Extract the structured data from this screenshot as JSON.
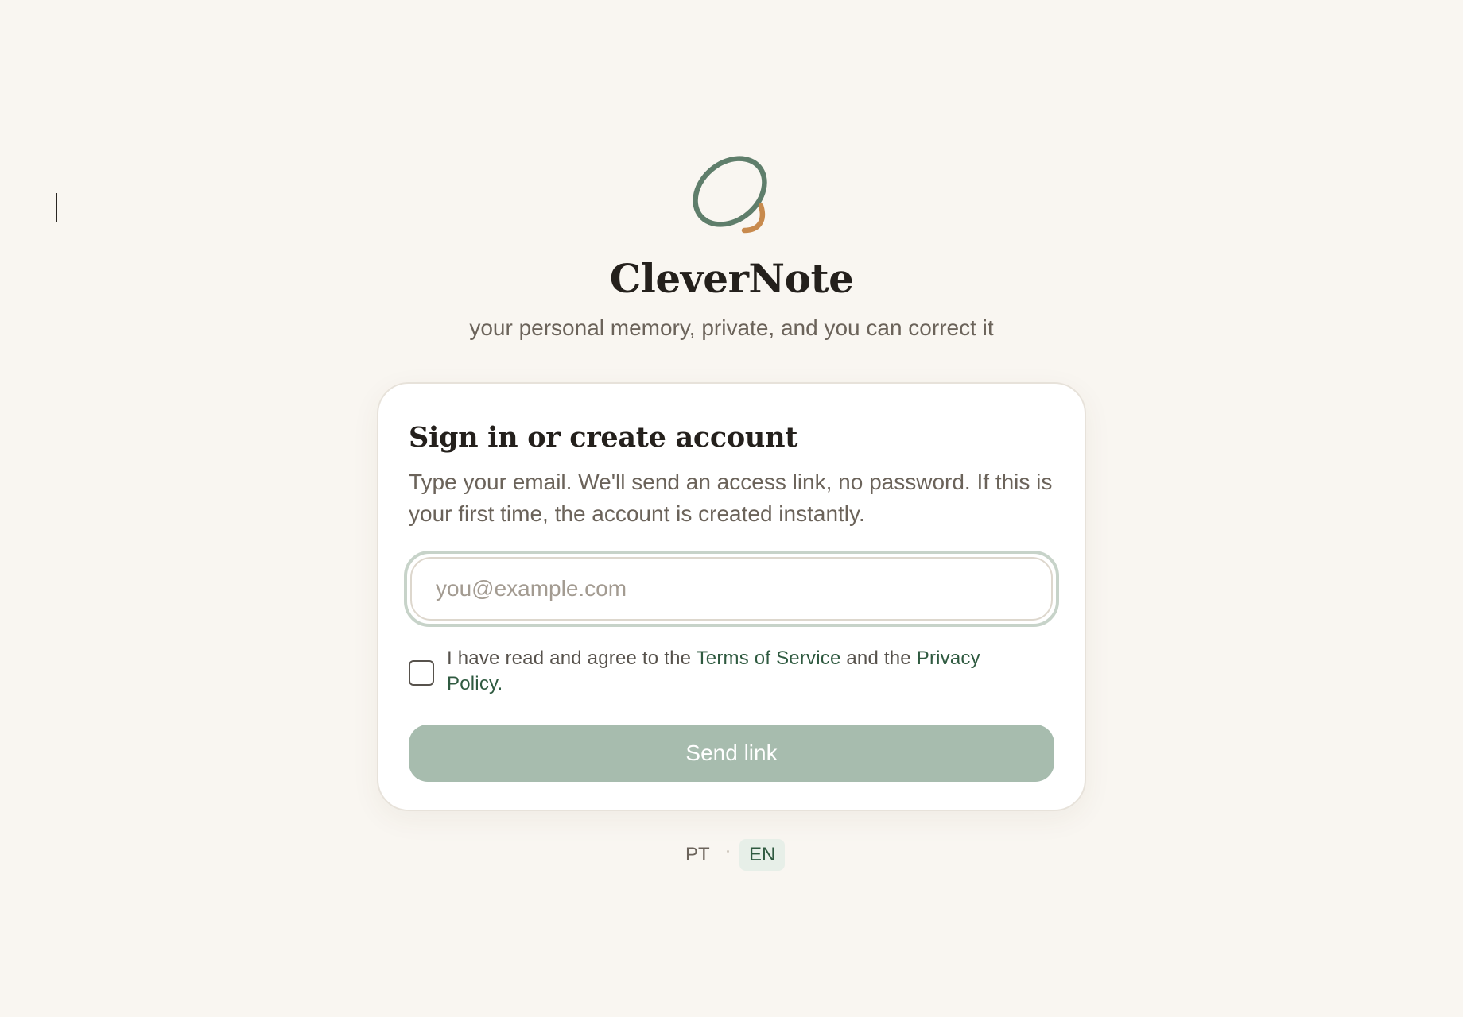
{
  "app": {
    "name": "CleverNote",
    "tagline": "your personal memory, private, and you can correct it",
    "logo_icon": "orbit-loop-logo",
    "colors": {
      "background": "#f9f6f1",
      "accent_green": "#5f7e6b",
      "accent_orange": "#c88a4d",
      "button": "#a7bcae",
      "link": "#2f5a40"
    }
  },
  "card": {
    "title": "Sign in or create account",
    "description": "Type your email. We'll send an access link, no password. If this is your first time, the account is created instantly.",
    "email": {
      "value": "",
      "placeholder": "you@example.com"
    },
    "terms": {
      "checked": false,
      "prefix": "I have read and agree to the ",
      "terms_link": "Terms of Service",
      "middle": " and the ",
      "privacy_link": "Privacy Policy",
      "suffix": "."
    },
    "submit_label": "Send link"
  },
  "language": {
    "options": [
      "PT",
      "EN"
    ],
    "selected": "EN"
  }
}
